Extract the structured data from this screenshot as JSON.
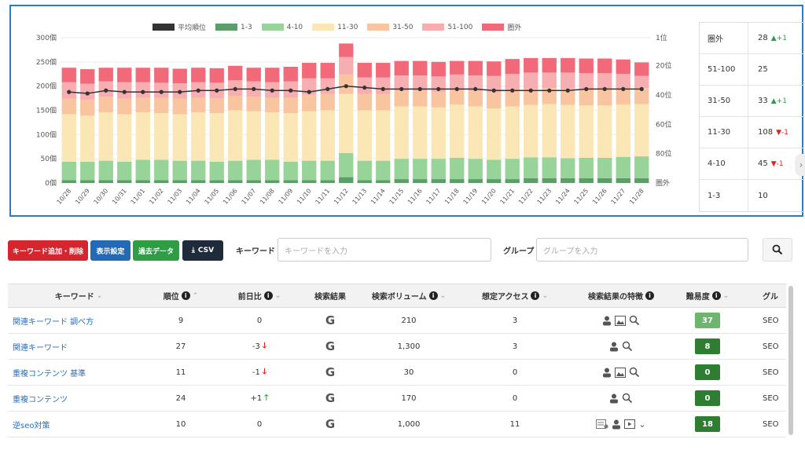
{
  "chart_data": {
    "type": "bar",
    "stacked": true,
    "categories": [
      "10/28",
      "10/29",
      "10/30",
      "10/31",
      "11/01",
      "11/02",
      "11/03",
      "11/04",
      "11/05",
      "11/06",
      "11/07",
      "11/08",
      "11/09",
      "11/10",
      "11/11",
      "11/12",
      "11/13",
      "11/14",
      "11/15",
      "11/16",
      "11/17",
      "11/18",
      "11/19",
      "11/20",
      "11/21",
      "11/22",
      "11/23",
      "11/24",
      "11/25",
      "11/26",
      "11/27",
      "11/28"
    ],
    "series": [
      {
        "name": "1-3",
        "color": "#5b9e6a",
        "values": [
          6,
          6,
          6,
          6,
          6,
          6,
          6,
          6,
          6,
          6,
          6,
          6,
          6,
          6,
          6,
          12,
          6,
          6,
          8,
          8,
          8,
          8,
          8,
          8,
          8,
          10,
          10,
          10,
          10,
          10,
          10,
          10
        ]
      },
      {
        "name": "4-10",
        "color": "#98d39a",
        "values": [
          38,
          38,
          40,
          38,
          42,
          42,
          40,
          40,
          38,
          40,
          42,
          42,
          38,
          40,
          40,
          50,
          40,
          40,
          42,
          42,
          42,
          44,
          42,
          40,
          42,
          43,
          43,
          41,
          42,
          42,
          44,
          45
        ]
      },
      {
        "name": "11-30",
        "color": "#fbe7b6",
        "values": [
          98,
          95,
          100,
          98,
          98,
          96,
          96,
          100,
          100,
          104,
          100,
          98,
          100,
          102,
          104,
          122,
          104,
          104,
          108,
          108,
          106,
          110,
          108,
          106,
          108,
          108,
          110,
          110,
          108,
          108,
          108,
          108
        ]
      },
      {
        "name": "31-50",
        "color": "#f9c4a0",
        "values": [
          32,
          33,
          32,
          33,
          30,
          32,
          32,
          30,
          31,
          30,
          30,
          30,
          32,
          34,
          34,
          40,
          34,
          34,
          32,
          32,
          32,
          30,
          32,
          33,
          33,
          33,
          33,
          33,
          33,
          33,
          33,
          33
        ]
      },
      {
        "name": "51-100",
        "color": "#f7aeb0",
        "values": [
          34,
          33,
          32,
          33,
          32,
          31,
          32,
          32,
          32,
          32,
          32,
          32,
          34,
          34,
          32,
          36,
          34,
          34,
          32,
          32,
          32,
          32,
          32,
          34,
          34,
          34,
          32,
          34,
          34,
          34,
          30,
          25
        ]
      },
      {
        "name": "圏外",
        "color": "#f26979",
        "values": [
          30,
          30,
          28,
          30,
          30,
          31,
          30,
          30,
          30,
          30,
          28,
          30,
          30,
          32,
          32,
          28,
          30,
          30,
          30,
          30,
          30,
          28,
          30,
          30,
          31,
          30,
          30,
          30,
          30,
          30,
          30,
          28
        ]
      }
    ],
    "line": {
      "name": "平均順位",
      "color": "#333333",
      "values": [
        38,
        39,
        37,
        38,
        38,
        38,
        38,
        37,
        37,
        36,
        36,
        37,
        37,
        38,
        36,
        34,
        35,
        36,
        36,
        36,
        36,
        36,
        36,
        37,
        37,
        37,
        37,
        37,
        36,
        36,
        36,
        36
      ]
    },
    "ylabel_left_ticks": [
      "300個",
      "250個",
      "200個",
      "150個",
      "100個",
      "50個",
      "0個"
    ],
    "ylim_left": [
      0,
      300
    ],
    "ylabel_right_ticks": [
      "1位",
      "20位",
      "40位",
      "60位",
      "80位",
      "圏外"
    ],
    "ylim_right": [
      1,
      100
    ],
    "legend_position": "top"
  },
  "summary": [
    {
      "label": "圏外",
      "value": "28",
      "change": "▲+1",
      "dir": "up"
    },
    {
      "label": "51-100",
      "value": "25",
      "change": "",
      "dir": ""
    },
    {
      "label": "31-50",
      "value": "33",
      "change": "▲+1",
      "dir": "up"
    },
    {
      "label": "11-30",
      "value": "108",
      "change": "▼-1",
      "dir": "down"
    },
    {
      "label": "4-10",
      "value": "45",
      "change": "▼-1",
      "dir": "down"
    },
    {
      "label": "1-3",
      "value": "10",
      "change": "",
      "dir": ""
    }
  ],
  "toolbar": {
    "add_delete_label": "キーワード追加・削除",
    "display_settings_label": "表示設定",
    "past_data_label": "過去データ",
    "csv_label": "CSV",
    "keyword_label": "キーワード",
    "keyword_placeholder": "キーワードを入力",
    "group_label": "グループ",
    "group_placeholder": "グループを入力",
    "colors": {
      "red": "#d4262e",
      "blue": "#2469b5",
      "green": "#2e9d44",
      "dark": "#1f2a3a"
    }
  },
  "table": {
    "headers": {
      "keyword": "キーワード",
      "rank": "順位",
      "prev": "前日比",
      "results": "検索結果",
      "volume": "検索ボリューム",
      "access": "想定アクセス",
      "features": "検索結果の特徴",
      "difficulty": "難易度",
      "group": "グル"
    },
    "rows": [
      {
        "keyword": "関連キーワード 調べ方",
        "rank": "9",
        "prev": "0",
        "arrow": "",
        "volume": "210",
        "access": "3",
        "features": [
          "person",
          "image",
          "search"
        ],
        "difficulty": "37",
        "diff_color": "#6db56f",
        "group": "SEO"
      },
      {
        "keyword": "関連キーワード",
        "rank": "27",
        "prev": "-3",
        "arrow": "down",
        "volume": "1,300",
        "access": "3",
        "features": [
          "person",
          "search"
        ],
        "difficulty": "8",
        "diff_color": "#2e7d32",
        "group": "SEO"
      },
      {
        "keyword": "重複コンテンツ 基準",
        "rank": "11",
        "prev": "-1",
        "arrow": "down",
        "volume": "30",
        "access": "0",
        "features": [
          "person",
          "image",
          "search"
        ],
        "difficulty": "0",
        "diff_color": "#2e7d32",
        "group": "SEO"
      },
      {
        "keyword": "重複コンテンツ",
        "rank": "24",
        "prev": "+1",
        "arrow": "up",
        "volume": "170",
        "access": "0",
        "features": [
          "person",
          "search"
        ],
        "difficulty": "0",
        "diff_color": "#2e7d32",
        "group": "SEO"
      },
      {
        "keyword": "逆seo対策",
        "rank": "10",
        "prev": "0",
        "arrow": "",
        "volume": "1,000",
        "access": "11",
        "features": [
          "news",
          "person",
          "video",
          "chevron"
        ],
        "difficulty": "18",
        "diff_color": "#2e7d32",
        "group": "SEO"
      }
    ]
  }
}
